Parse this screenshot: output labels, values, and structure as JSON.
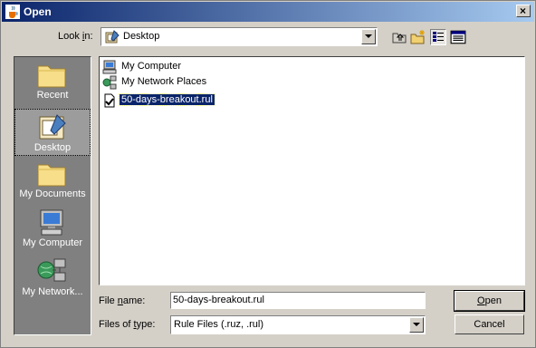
{
  "window": {
    "title": "Open"
  },
  "look_in": {
    "label_pre": "Look ",
    "label_ul": "i",
    "label_post": "n:",
    "value": "Desktop"
  },
  "toolbar": {
    "icons": [
      "up-one-level-icon",
      "new-folder-icon",
      "list-view-icon",
      "details-view-icon"
    ]
  },
  "places": [
    {
      "label": "Recent"
    },
    {
      "label": "Desktop"
    },
    {
      "label": "My Documents"
    },
    {
      "label": "My Computer"
    },
    {
      "label": "My Network..."
    }
  ],
  "files": [
    {
      "name": "My Computer"
    },
    {
      "name": "My Network Places"
    },
    {
      "name": "50-days-breakout.rul"
    }
  ],
  "filename": {
    "label_pre": "File ",
    "label_ul": "n",
    "label_post": "ame:",
    "value": "50-days-breakout.rul"
  },
  "filetype": {
    "label_pre": "Files of ",
    "label_ul": "t",
    "label_post": "ype:",
    "value": "Rule Files (.ruz, .rul)"
  },
  "buttons": {
    "open_ul": "O",
    "open_rest": "pen",
    "cancel": "Cancel"
  },
  "colors": {
    "title_start": "#0a246a",
    "title_end": "#a6caf0",
    "selection": "#0a246a",
    "places_bg": "#808080"
  }
}
